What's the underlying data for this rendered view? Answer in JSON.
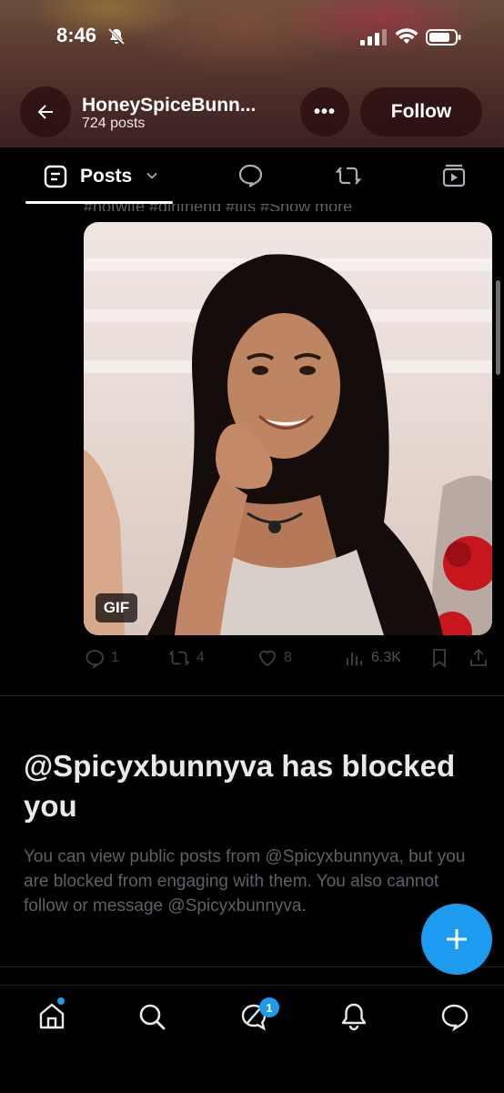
{
  "status_bar": {
    "time": "8:46"
  },
  "header": {
    "profile_name": "HoneySpiceBunn...",
    "post_count": "724 posts",
    "more_label": "•••",
    "follow_label": "Follow"
  },
  "tabs": {
    "posts_label": "Posts"
  },
  "feed": {
    "cutoff_text": "#hotwife #girlfriend #tits #Show more",
    "gif_badge": "GIF",
    "post_actions": {
      "replies": "1",
      "reposts": "4",
      "likes": "8",
      "views": "6.3K"
    }
  },
  "blocked": {
    "title": "@Spicyxbunnyva has blocked you",
    "description": "You can view public posts from @Spicyxbunnyva, but you are blocked from engaging with them. You also cannot follow or message @Spicyxbunnyva."
  },
  "bottom_nav": {
    "messages_badge": "1"
  },
  "colors": {
    "accent": "#1d9bf0",
    "background": "#000000",
    "text": "#e7e9ea",
    "muted": "#5c6268"
  }
}
